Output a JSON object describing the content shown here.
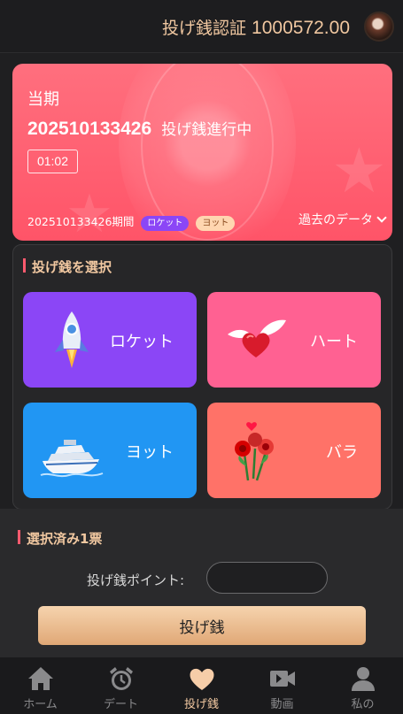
{
  "header": {
    "balance_label": "投げ銭認証",
    "balance_value": "1000572.00"
  },
  "hero": {
    "period_label": "当期",
    "issue_number": "202510133426",
    "issue_status": "投げ銭進行中",
    "timer": "01:02",
    "history_text": "202510133426期間",
    "history_badges": [
      "ロケット",
      "ヨット"
    ],
    "past_data_label": "過去のデータ"
  },
  "select_section": {
    "title": "投げ銭を選択",
    "cards": [
      {
        "label": "ロケット",
        "icon": "rocket-icon",
        "color": "#8b46f6"
      },
      {
        "label": "ハート",
        "icon": "winged-heart-icon",
        "color": "#ff6192"
      },
      {
        "label": "ヨット",
        "icon": "yacht-icon",
        "color": "#2196f3"
      },
      {
        "label": "バラ",
        "icon": "roses-icon",
        "color": "#ff7268"
      }
    ]
  },
  "selected_section": {
    "title": "選択済み1票",
    "points_label": "投げ銭ポイント:",
    "points_value": "",
    "submit_label": "投げ銭"
  },
  "tabs": [
    {
      "label": "ホーム",
      "icon": "home-icon",
      "active": false
    },
    {
      "label": "デート",
      "icon": "alarm-clock-icon",
      "active": false
    },
    {
      "label": "投げ銭",
      "icon": "heart-icon",
      "active": true
    },
    {
      "label": "動画",
      "icon": "video-camera-icon",
      "active": false
    },
    {
      "label": "私の",
      "icon": "user-icon",
      "active": false
    }
  ],
  "colors": {
    "accent": "#f0c7a0",
    "hero": "#ff5468",
    "background": "#1f1f21"
  }
}
